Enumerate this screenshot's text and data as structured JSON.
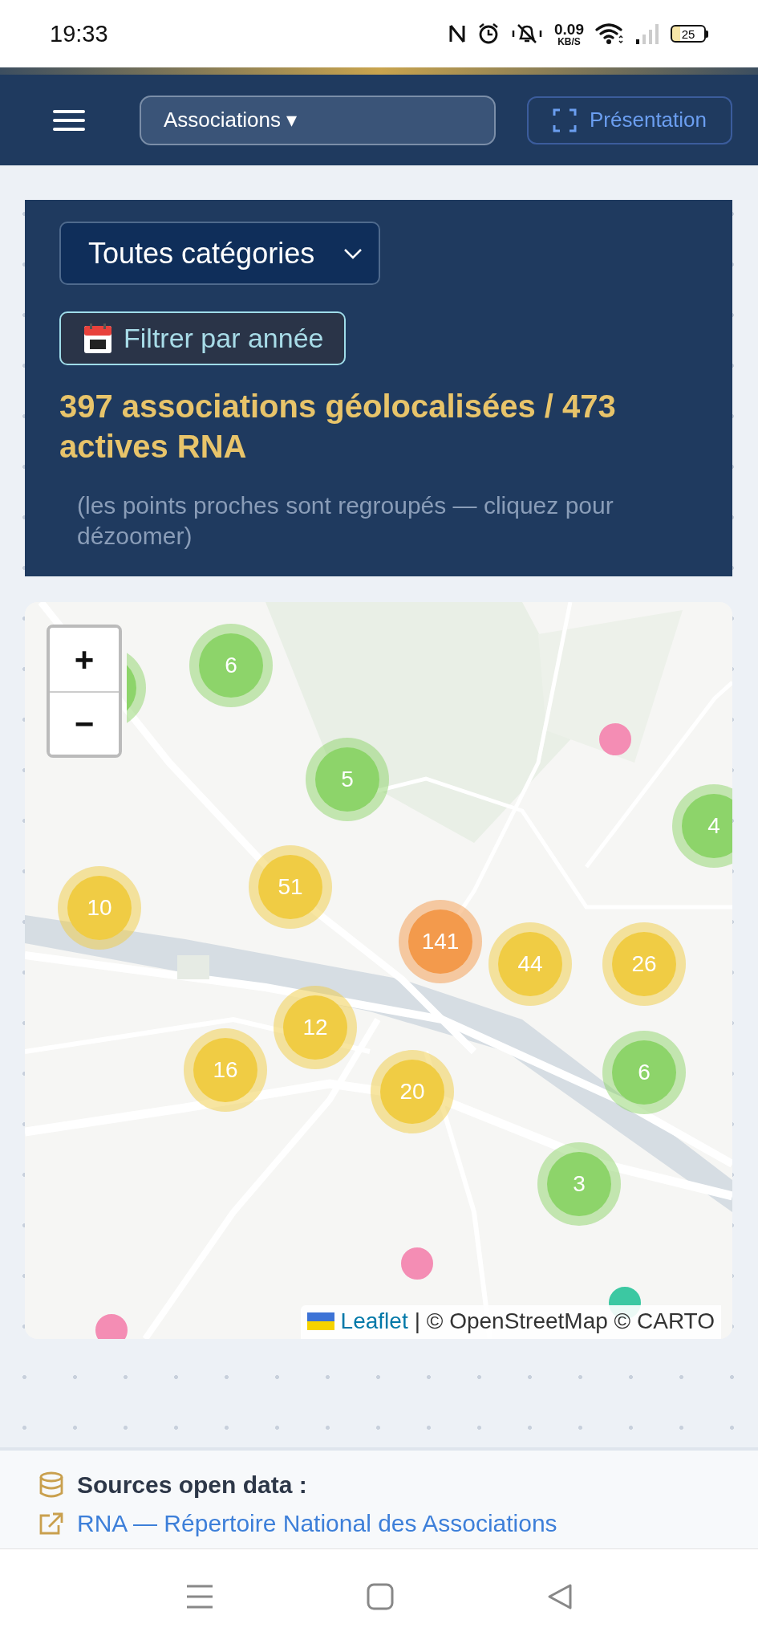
{
  "status_bar": {
    "time": "19:33",
    "net_speed": "0.09",
    "net_unit": "KB/S",
    "battery": "25"
  },
  "header": {
    "dataset_select": {
      "value": "Associations",
      "caret": "▾"
    },
    "present_button": "Présentation"
  },
  "filters": {
    "category_select": {
      "value": "Toutes catégories"
    },
    "year_button": {
      "label": "Filtrer par année"
    },
    "summary": "397 associations géolocalisées / 473 actives RNA",
    "hint": "(les points proches sont regroupés — cliquez pour dézoomer)"
  },
  "map": {
    "zoom_in": "+",
    "zoom_out": "−",
    "points": [
      {
        "kind": "cluster",
        "color": "#8dd46a"
      },
      {
        "kind": "cluster",
        "count": "6",
        "color": "#8dd46a"
      },
      {
        "kind": "cluster",
        "count": "5",
        "color": "#8dd46a"
      },
      {
        "kind": "marker",
        "color": "#f48db4"
      },
      {
        "kind": "cluster",
        "count": "4",
        "color": "#8dd46a"
      },
      {
        "kind": "cluster",
        "count": "51",
        "color": "#f0cc44"
      },
      {
        "kind": "cluster",
        "count": "10",
        "color": "#f0cc44"
      },
      {
        "kind": "cluster",
        "count": "141",
        "color": "#f39a4c"
      },
      {
        "kind": "cluster",
        "count": "44",
        "color": "#f0cc44"
      },
      {
        "kind": "cluster",
        "count": "26",
        "color": "#f0cc44"
      },
      {
        "kind": "cluster",
        "count": "12",
        "color": "#f0cc44"
      },
      {
        "kind": "cluster",
        "count": "16",
        "color": "#f0cc44"
      },
      {
        "kind": "cluster",
        "count": "20",
        "color": "#f0cc44"
      },
      {
        "kind": "cluster",
        "count": "6",
        "color": "#8dd46a"
      },
      {
        "kind": "cluster",
        "count": "3",
        "color": "#8dd46a"
      },
      {
        "kind": "marker",
        "color": "#f48db4"
      },
      {
        "kind": "marker",
        "color": "#f48db4"
      },
      {
        "kind": "marker",
        "color": "#3cc8a2"
      }
    ],
    "attribution": {
      "link": "Leaflet",
      "text": "| © OpenStreetMap © CARTO"
    }
  },
  "sources": {
    "title": "Sources open data :",
    "links": [
      "RNA — Répertoire National des Associations"
    ]
  }
}
